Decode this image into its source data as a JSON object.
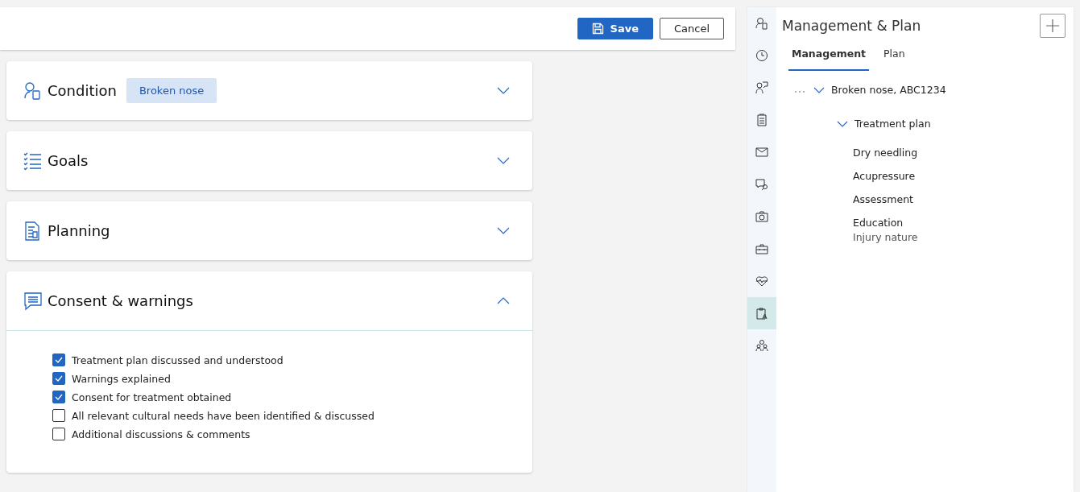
{
  "toolbar": {
    "buttons": [
      {
        "label": "Save",
        "kind": "primary"
      },
      {
        "label": "Cancel",
        "kind": "secondary"
      }
    ]
  },
  "sections": [
    {
      "title": "Condition",
      "badge": "Broken nose",
      "expanded": false
    },
    {
      "title": "Goals",
      "expanded": false
    },
    {
      "title": "Planning",
      "expanded": false
    },
    {
      "title": "Consent & warnings",
      "expanded": true,
      "checklist": [
        {
          "label": "Treatment plan discussed and understood",
          "checked": true
        },
        {
          "label": "Warnings explained",
          "checked": true
        },
        {
          "label": "Consent for treatment obtained",
          "checked": true
        },
        {
          "label": "All relevant cultural needs have been identified & discussed",
          "checked": false
        },
        {
          "label": "Additional discussions & comments",
          "checked": false
        }
      ]
    }
  ],
  "rail": [
    {
      "selected": false
    },
    {
      "selected": false
    },
    {
      "selected": false
    },
    {
      "selected": false
    },
    {
      "selected": false
    },
    {
      "selected": false
    },
    {
      "selected": false
    },
    {
      "selected": false
    },
    {
      "selected": false
    },
    {
      "selected": true
    },
    {
      "selected": false
    }
  ],
  "panel": {
    "title": "Management & Plan",
    "tabs": [
      {
        "label": "Management",
        "selected": true
      },
      {
        "label": "Plan",
        "selected": false
      }
    ],
    "tree": [
      {
        "label": "Broken nose, ABC1234",
        "expanded": true,
        "children": [
          {
            "label": "Treatment plan",
            "expanded": true,
            "children": [
              {
                "label": "Dry needling"
              },
              {
                "label": "Acupressure"
              },
              {
                "label": "Assessment"
              },
              {
                "label": "Education",
                "subtitle": "Injury nature"
              }
            ]
          }
        ]
      }
    ]
  }
}
